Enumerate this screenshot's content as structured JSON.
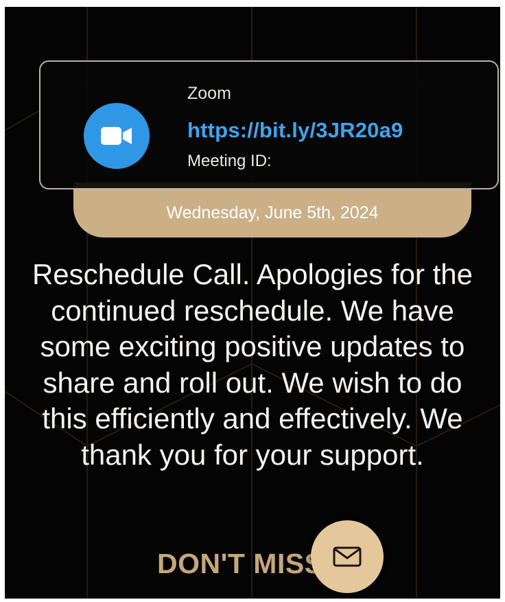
{
  "zoom_card": {
    "app_name": "Zoom",
    "link": "https://bit.ly/3JR20a9",
    "meeting_id_label": "Meeting ID:"
  },
  "date_bar": {
    "date": "Wednesday, June 5th, 2024"
  },
  "message": {
    "text": "Reschedule Call. Apologies for the continued reschedule. We have some exciting positive updates to share and roll out. We wish to do this efficiently and effectively. We thank you for your support."
  },
  "cta": {
    "visible_text": "DON'T MISS"
  },
  "icons": {
    "zoom_logo": "video-camera-icon",
    "fab": "envelope-icon"
  },
  "colors": {
    "background": "#050404",
    "accent_gold": "#cbb086",
    "link_blue": "#3ca6f0",
    "zoom_blue": "#2f97e6"
  }
}
